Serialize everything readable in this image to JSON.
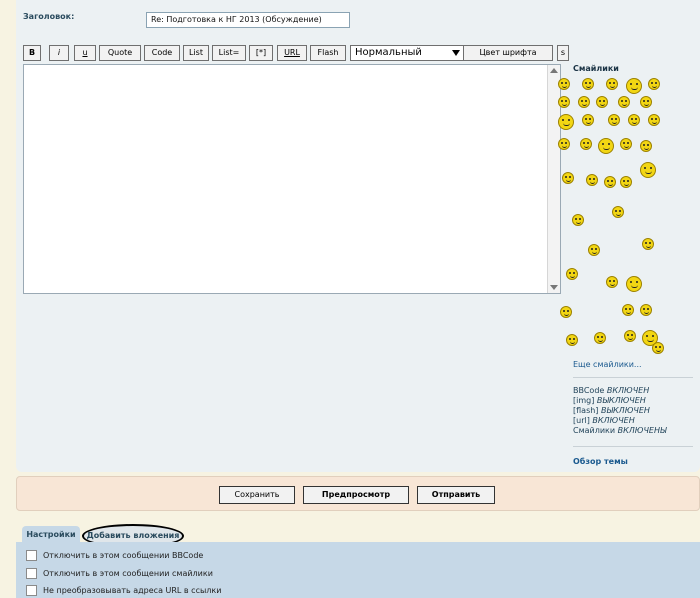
{
  "subject": {
    "label": "Заголовок:",
    "value": "Re: Подготовка к НГ 2013 (Обсуждение)"
  },
  "toolbar": {
    "buttons": [
      "B",
      "i",
      "u",
      "Quote",
      "Code",
      "List",
      "List=",
      "[*]",
      "URL",
      "Flash"
    ],
    "font_size_select": "Нормальный",
    "font_color_button": "Цвет шрифта",
    "small_button": "s"
  },
  "smilies": {
    "title": "Смайлики",
    "more_link": "Еще смайлики...",
    "count": 40
  },
  "bbcode_status": [
    {
      "label": "BBCode",
      "state": "ВКЛЮЧЕН"
    },
    {
      "label": "[img]",
      "state": "ВЫКЛЮЧЕН"
    },
    {
      "label": "[flash]",
      "state": "ВЫКЛЮЧЕН"
    },
    {
      "label": "[url]",
      "state": "ВКЛЮЧЕН"
    },
    {
      "label": "Смайлики",
      "state": "ВКЛЮЧЕНЫ"
    }
  ],
  "topic_review_link": "Обзор темы",
  "actions": {
    "save": "Сохранить",
    "preview": "Предпросмотр",
    "submit": "Отправить"
  },
  "tabs": {
    "settings": "Настройки",
    "attachments": "Добавить вложения"
  },
  "options": [
    "Отключить в этом сообщении BBCode",
    "Отключить в этом сообщении смайлики",
    "Не преобразовывать адреса URL в ссылки"
  ]
}
